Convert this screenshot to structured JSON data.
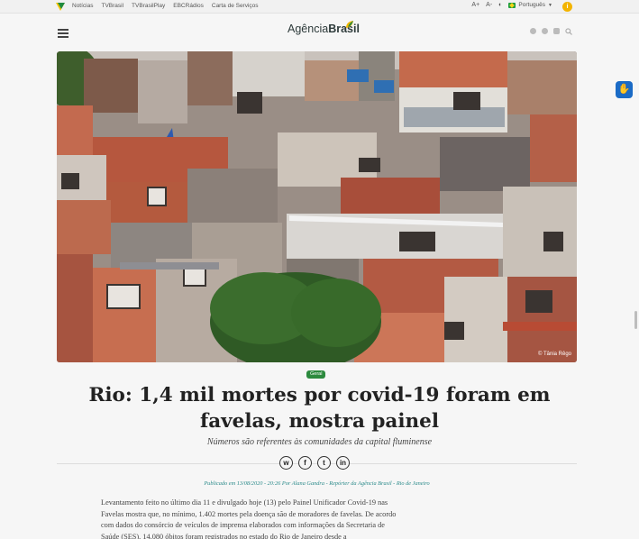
{
  "topbar": {
    "links": [
      "Notícias",
      "TVBrasil",
      "TVBrasilPlay",
      "EBCRádios",
      "Carta de Serviços"
    ],
    "font_up": "A+",
    "font_down": "A-",
    "language": "Português"
  },
  "header": {
    "logo_light": "Agência",
    "logo_bold": "Brasil"
  },
  "hero": {
    "credit": "© Tânia Rêgo"
  },
  "article": {
    "tag": "Geral",
    "title": "Rio: 1,4 mil mortes por covid-19 foram em favelas, mostra painel",
    "subtitle": "Números são referentes às comunidades da capital fluminense",
    "published": "Publicado em 13/08/2020 - 20:26 Por Alana Gandra - Repórter da Agência Brasil - Rio de Janeiro",
    "body": "Levantamento feito no último dia 11 e divulgado hoje (13) pelo Painel Unificador Covid-19 nas Favelas mostra que, no mínimo, 1.402 mortes pela doença são de moradores de favelas. De acordo com dados do consórcio de veículos de imprensa elaborados com informações da Secretaria de Saúde (SES), 14.080 óbitos foram registrados no estado do Rio de Janeiro desde a"
  },
  "share": {
    "whatsapp": "w",
    "facebook": "f",
    "twitter": "t",
    "linkedin": "in"
  },
  "colors": {
    "tag_green": "#2c8a3e",
    "byline_teal": "#2a8a8a",
    "a11y_blue": "#1b6bc6"
  }
}
